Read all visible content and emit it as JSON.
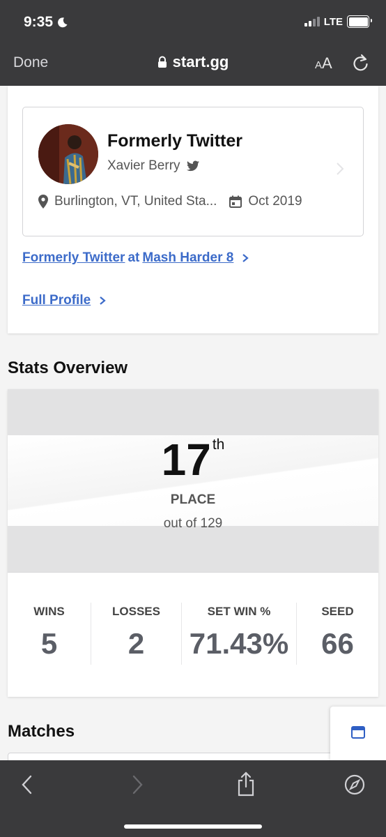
{
  "status_bar": {
    "time": "9:35",
    "network": "LTE"
  },
  "browser": {
    "done_label": "Done",
    "url": "start.gg",
    "text_size_small": "A",
    "text_size_large": "A"
  },
  "profile": {
    "name": "Formerly Twitter",
    "real_name": "Xavier Berry",
    "location": "Burlington, VT, United Sta...",
    "joined": "Oct 2019",
    "tournament_link": {
      "player": "Formerly Twitter",
      "at": "at",
      "event": "Mash Harder 8"
    },
    "full_profile_label": "Full Profile"
  },
  "stats_overview": {
    "title": "Stats Overview",
    "place": "17",
    "place_suffix": "th",
    "place_label": "PLACE",
    "out_of": "out of 129",
    "stats": [
      {
        "label": "WINS",
        "value": "5"
      },
      {
        "label": "LOSSES",
        "value": "2"
      },
      {
        "label": "SET WIN %",
        "value": "71.43%"
      },
      {
        "label": "SEED",
        "value": "66"
      }
    ]
  },
  "matches": {
    "title": "Matches"
  },
  "colors": {
    "link": "#3c6bc9",
    "chrome": "#3a3a3c",
    "accent_icon": "#2f5fc4"
  }
}
